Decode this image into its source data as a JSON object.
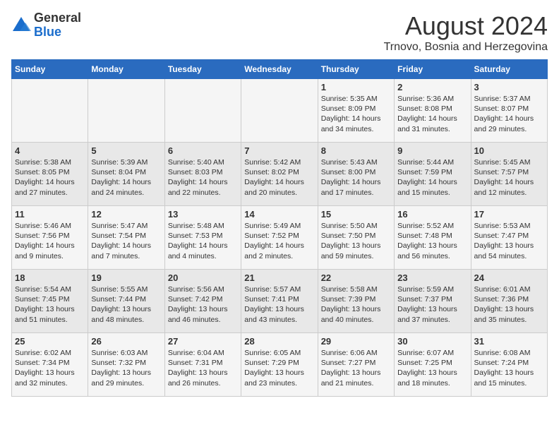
{
  "logo": {
    "general": "General",
    "blue": "Blue"
  },
  "title": "August 2024",
  "location": "Trnovo, Bosnia and Herzegovina",
  "days_of_week": [
    "Sunday",
    "Monday",
    "Tuesday",
    "Wednesday",
    "Thursday",
    "Friday",
    "Saturday"
  ],
  "weeks": [
    [
      {
        "day": "",
        "info": ""
      },
      {
        "day": "",
        "info": ""
      },
      {
        "day": "",
        "info": ""
      },
      {
        "day": "",
        "info": ""
      },
      {
        "day": "1",
        "info": "Sunrise: 5:35 AM\nSunset: 8:09 PM\nDaylight: 14 hours and 34 minutes."
      },
      {
        "day": "2",
        "info": "Sunrise: 5:36 AM\nSunset: 8:08 PM\nDaylight: 14 hours and 31 minutes."
      },
      {
        "day": "3",
        "info": "Sunrise: 5:37 AM\nSunset: 8:07 PM\nDaylight: 14 hours and 29 minutes."
      }
    ],
    [
      {
        "day": "4",
        "info": "Sunrise: 5:38 AM\nSunset: 8:05 PM\nDaylight: 14 hours and 27 minutes."
      },
      {
        "day": "5",
        "info": "Sunrise: 5:39 AM\nSunset: 8:04 PM\nDaylight: 14 hours and 24 minutes."
      },
      {
        "day": "6",
        "info": "Sunrise: 5:40 AM\nSunset: 8:03 PM\nDaylight: 14 hours and 22 minutes."
      },
      {
        "day": "7",
        "info": "Sunrise: 5:42 AM\nSunset: 8:02 PM\nDaylight: 14 hours and 20 minutes."
      },
      {
        "day": "8",
        "info": "Sunrise: 5:43 AM\nSunset: 8:00 PM\nDaylight: 14 hours and 17 minutes."
      },
      {
        "day": "9",
        "info": "Sunrise: 5:44 AM\nSunset: 7:59 PM\nDaylight: 14 hours and 15 minutes."
      },
      {
        "day": "10",
        "info": "Sunrise: 5:45 AM\nSunset: 7:57 PM\nDaylight: 14 hours and 12 minutes."
      }
    ],
    [
      {
        "day": "11",
        "info": "Sunrise: 5:46 AM\nSunset: 7:56 PM\nDaylight: 14 hours and 9 minutes."
      },
      {
        "day": "12",
        "info": "Sunrise: 5:47 AM\nSunset: 7:54 PM\nDaylight: 14 hours and 7 minutes."
      },
      {
        "day": "13",
        "info": "Sunrise: 5:48 AM\nSunset: 7:53 PM\nDaylight: 14 hours and 4 minutes."
      },
      {
        "day": "14",
        "info": "Sunrise: 5:49 AM\nSunset: 7:52 PM\nDaylight: 14 hours and 2 minutes."
      },
      {
        "day": "15",
        "info": "Sunrise: 5:50 AM\nSunset: 7:50 PM\nDaylight: 13 hours and 59 minutes."
      },
      {
        "day": "16",
        "info": "Sunrise: 5:52 AM\nSunset: 7:48 PM\nDaylight: 13 hours and 56 minutes."
      },
      {
        "day": "17",
        "info": "Sunrise: 5:53 AM\nSunset: 7:47 PM\nDaylight: 13 hours and 54 minutes."
      }
    ],
    [
      {
        "day": "18",
        "info": "Sunrise: 5:54 AM\nSunset: 7:45 PM\nDaylight: 13 hours and 51 minutes."
      },
      {
        "day": "19",
        "info": "Sunrise: 5:55 AM\nSunset: 7:44 PM\nDaylight: 13 hours and 48 minutes."
      },
      {
        "day": "20",
        "info": "Sunrise: 5:56 AM\nSunset: 7:42 PM\nDaylight: 13 hours and 46 minutes."
      },
      {
        "day": "21",
        "info": "Sunrise: 5:57 AM\nSunset: 7:41 PM\nDaylight: 13 hours and 43 minutes."
      },
      {
        "day": "22",
        "info": "Sunrise: 5:58 AM\nSunset: 7:39 PM\nDaylight: 13 hours and 40 minutes."
      },
      {
        "day": "23",
        "info": "Sunrise: 5:59 AM\nSunset: 7:37 PM\nDaylight: 13 hours and 37 minutes."
      },
      {
        "day": "24",
        "info": "Sunrise: 6:01 AM\nSunset: 7:36 PM\nDaylight: 13 hours and 35 minutes."
      }
    ],
    [
      {
        "day": "25",
        "info": "Sunrise: 6:02 AM\nSunset: 7:34 PM\nDaylight: 13 hours and 32 minutes."
      },
      {
        "day": "26",
        "info": "Sunrise: 6:03 AM\nSunset: 7:32 PM\nDaylight: 13 hours and 29 minutes."
      },
      {
        "day": "27",
        "info": "Sunrise: 6:04 AM\nSunset: 7:31 PM\nDaylight: 13 hours and 26 minutes."
      },
      {
        "day": "28",
        "info": "Sunrise: 6:05 AM\nSunset: 7:29 PM\nDaylight: 13 hours and 23 minutes."
      },
      {
        "day": "29",
        "info": "Sunrise: 6:06 AM\nSunset: 7:27 PM\nDaylight: 13 hours and 21 minutes."
      },
      {
        "day": "30",
        "info": "Sunrise: 6:07 AM\nSunset: 7:25 PM\nDaylight: 13 hours and 18 minutes."
      },
      {
        "day": "31",
        "info": "Sunrise: 6:08 AM\nSunset: 7:24 PM\nDaylight: 13 hours and 15 minutes."
      }
    ]
  ]
}
